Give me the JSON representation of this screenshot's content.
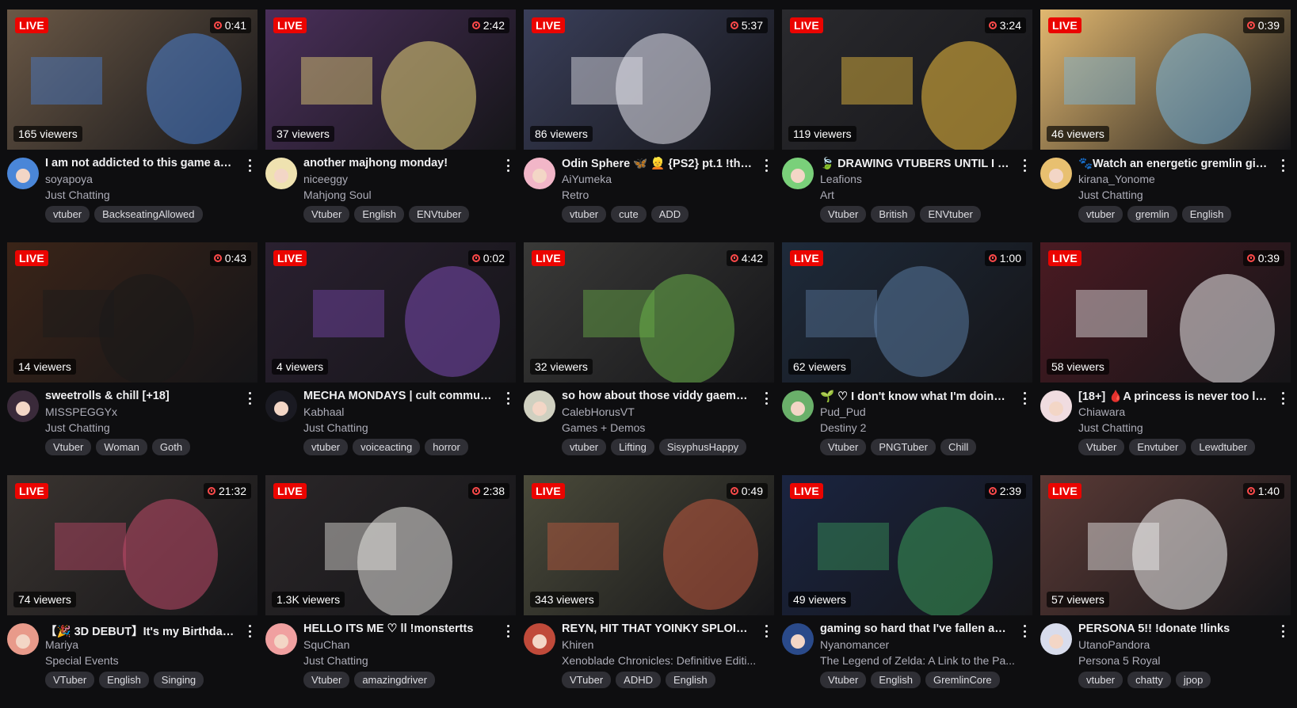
{
  "live_label": "LIVE",
  "streams": [
    {
      "title": "I am not addicted to this game as ...",
      "channel": "soyapoya",
      "category": "Just Chatting",
      "uptime": "0:41",
      "viewers": "165 viewers",
      "tags": [
        "vtuber",
        "BackseatingAllowed"
      ],
      "thumb_color": "#6a5846",
      "thumb_accent": "#4a7fd0",
      "avatar_color": "#4a86d8"
    },
    {
      "title": "another majhong monday!",
      "channel": "niceeggy",
      "category": "Mahjong Soul",
      "uptime": "2:42",
      "viewers": "37 viewers",
      "tags": [
        "Vtuber",
        "English",
        "ENVtuber"
      ],
      "thumb_color": "#4a2f5a",
      "thumb_accent": "#e8d57a",
      "avatar_color": "#efe2b0"
    },
    {
      "title": "Odin Sphere 🦋 👱 {PS2} pt.1 !thro...",
      "channel": "AiYumeka",
      "category": "Retro",
      "uptime": "5:37",
      "viewers": "86 viewers",
      "tags": [
        "vtuber",
        "cute",
        "ADD"
      ],
      "thumb_color": "#3a3f5a",
      "thumb_accent": "#e8e8f0",
      "avatar_color": "#f2b6c8"
    },
    {
      "title": "🍃 DRAWING VTUBERS UNTIL I E...",
      "channel": "Leafions",
      "category": "Art",
      "uptime": "3:24",
      "viewers": "119 viewers",
      "tags": [
        "Vtuber",
        "British",
        "ENVtuber"
      ],
      "thumb_color": "#2a2a2e",
      "thumb_accent": "#f0c040",
      "avatar_color": "#7ad07a"
    },
    {
      "title": "🐾Watch an energetic gremlin girl...",
      "channel": "kirana_Yonome",
      "category": "Just Chatting",
      "uptime": "0:39",
      "viewers": "46 viewers",
      "tags": [
        "vtuber",
        "gremlin",
        "English"
      ],
      "thumb_color": "#e2b870",
      "thumb_accent": "#7ab8e0",
      "avatar_color": "#e8c070"
    },
    {
      "title": "sweetrolls & chill [+18]",
      "channel": "MISSPEGGYx",
      "category": "Just Chatting",
      "uptime": "0:43",
      "viewers": "14 viewers",
      "tags": [
        "Vtuber",
        "Woman",
        "Goth"
      ],
      "thumb_color": "#3a2418",
      "thumb_accent": "#1a1a1a",
      "avatar_color": "#3a2a3a"
    },
    {
      "title": "MECHA MONDAYS | cult communi...",
      "channel": "Kabhaal",
      "category": "Just Chatting",
      "uptime": "0:02",
      "viewers": "4 viewers",
      "tags": [
        "vtuber",
        "voiceacting",
        "horror"
      ],
      "thumb_color": "#2a2030",
      "thumb_accent": "#7a4ab0",
      "avatar_color": "#1a1a22"
    },
    {
      "title": "so how about those viddy gaems ...",
      "channel": "CalebHorusVT",
      "category": "Games + Demos",
      "uptime": "4:42",
      "viewers": "32 viewers",
      "tags": [
        "vtuber",
        "Lifting",
        "SisyphusHappy"
      ],
      "thumb_color": "#3a3a38",
      "thumb_accent": "#6ab04a",
      "avatar_color": "#d0d0c0"
    },
    {
      "title": "🌱 ♡ I don't know what I'm doing ...",
      "channel": "Pud_Pud",
      "category": "Destiny 2",
      "uptime": "1:00",
      "viewers": "62 viewers",
      "tags": [
        "Vtuber",
        "PNGTuber",
        "Chill"
      ],
      "thumb_color": "#1e2a3a",
      "thumb_accent": "#5a7aa0",
      "avatar_color": "#6ab06a"
    },
    {
      "title": "[18+] 🩸A princess is never too lat...",
      "channel": "Chiawara",
      "category": "Just Chatting",
      "uptime": "0:39",
      "viewers": "58 viewers",
      "tags": [
        "Vtuber",
        "Envtuber",
        "Lewdtuber"
      ],
      "thumb_color": "#4a1a22",
      "thumb_accent": "#f0eef0",
      "avatar_color": "#f0dce0"
    },
    {
      "title": "【🎉 3D DEBUT】It's my Birthday!...",
      "channel": "Mariya",
      "category": "Special Events",
      "uptime": "21:32",
      "viewers": "74 viewers",
      "tags": [
        "VTuber",
        "English",
        "Singing"
      ],
      "thumb_color": "#3a3430",
      "thumb_accent": "#c04a6a",
      "avatar_color": "#e89a8a"
    },
    {
      "title": "HELLO ITS ME ♡ ll !monstertts",
      "channel": "SquChan",
      "category": "Just Chatting",
      "uptime": "2:38",
      "viewers": "1.3K viewers",
      "tags": [
        "Vtuber",
        "amazingdriver"
      ],
      "thumb_color": "#2a2628",
      "thumb_accent": "#e8e6e2",
      "avatar_color": "#f0a0a0"
    },
    {
      "title": "REYN, HIT THAT YOINKY SPLOIN...",
      "channel": "Khiren",
      "category": "Xenoblade Chronicles: Definitive Editi...",
      "uptime": "0:49",
      "viewers": "343 viewers",
      "tags": [
        "VTuber",
        "ADHD",
        "English"
      ],
      "thumb_color": "#4a4a3a",
      "thumb_accent": "#c05a40",
      "avatar_color": "#c04a3a"
    },
    {
      "title": "gaming so hard that I've fallen an...",
      "channel": "Nyanomancer",
      "category": "The Legend of Zelda: A Link to the Pa...",
      "uptime": "2:39",
      "viewers": "49 viewers",
      "tags": [
        "Vtuber",
        "English",
        "GremlinCore"
      ],
      "thumb_color": "#1a2440",
      "thumb_accent": "#3a9a5a",
      "avatar_color": "#2a4a8a"
    },
    {
      "title": "PERSONA 5!! !donate !links",
      "channel": "UtanoPandora",
      "category": "Persona 5 Royal",
      "uptime": "1:40",
      "viewers": "57 viewers",
      "tags": [
        "vtuber",
        "chatty",
        "jpop"
      ],
      "thumb_color": "#5a3a36",
      "thumb_accent": "#f4f4f4",
      "avatar_color": "#d8dcec"
    }
  ]
}
